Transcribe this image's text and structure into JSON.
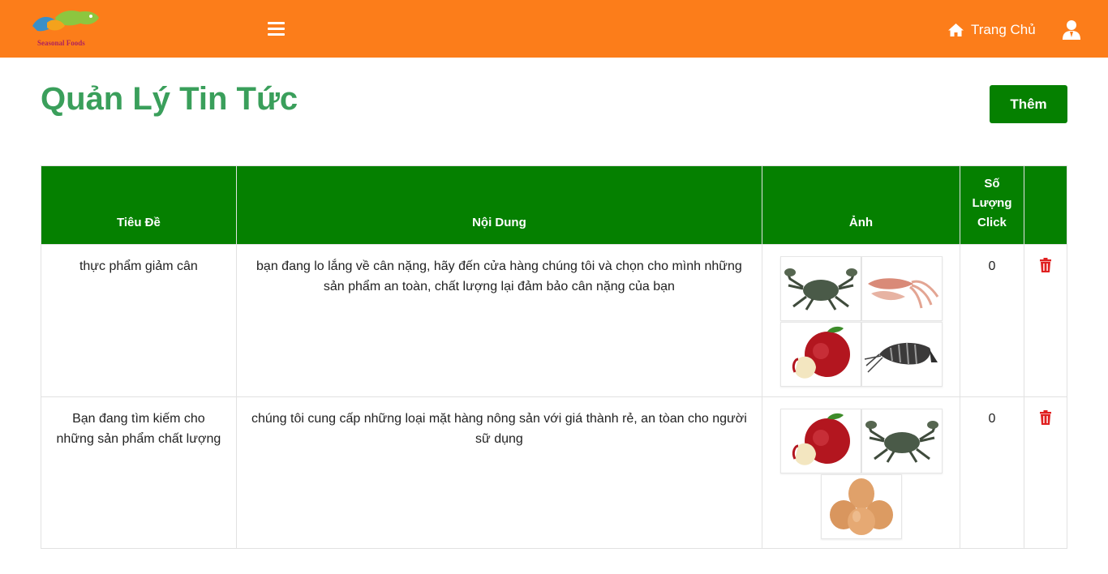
{
  "brand": {
    "logo_text": "Seasonal Foods"
  },
  "nav": {
    "home_label": "Trang Chủ"
  },
  "page": {
    "title": "Quản Lý Tin Tức",
    "add_label": "Thêm"
  },
  "table": {
    "headers": [
      "Tiêu Đề",
      "Nội Dung",
      "Ảnh",
      "Số Lượng Click",
      ""
    ],
    "rows": [
      {
        "title": "thực phẩm giảm cân",
        "content": "bạn đang lo lắng về cân nặng, hãy đến cửa hàng chúng tôi và chọn cho mình những sản phẩm an toàn, chất lượng lại đảm bảo cân nặng của bạn",
        "images": [
          "crab-image",
          "squid-image",
          "apple-image",
          "shrimp-image"
        ],
        "clicks": "0"
      },
      {
        "title": "Bạn đang tìm kiếm cho những sản phẩm chất lượng",
        "content": "chúng tôi cung cấp những loại mặt hàng nông sản với giá thành rẻ, an tòan cho người sữ dụng",
        "images": [
          "apple-image",
          "crab-image",
          "eggs-image"
        ],
        "clicks": "0"
      }
    ]
  },
  "colors": {
    "navbar": "#fc7d1a",
    "accent_green": "#058000",
    "title_green": "#3a9f5b",
    "delete_red": "#e02020"
  }
}
